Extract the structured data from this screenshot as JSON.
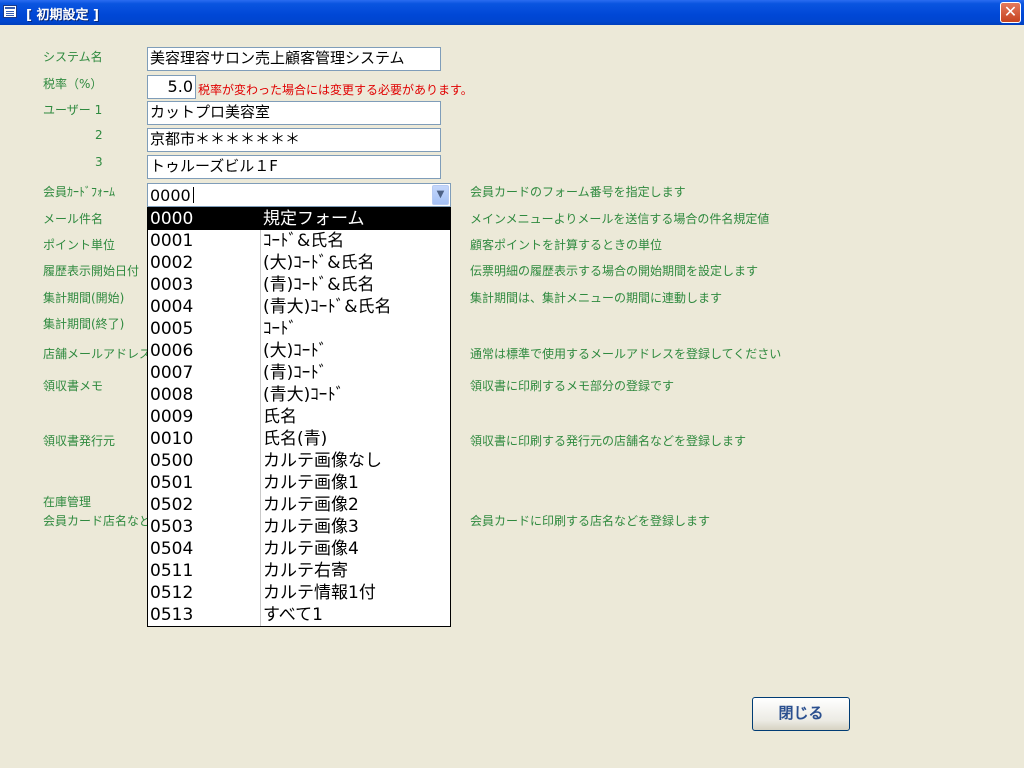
{
  "window": {
    "title": "[ 初期設定 ]",
    "close_glyph": "✕"
  },
  "labels": {
    "system_name": "システム名",
    "tax_rate": "税率（%）",
    "user1": "ユーザー 1",
    "user2": "2",
    "user3": "3",
    "card_form": "会員ｶｰﾄﾞﾌｫｰﾑ",
    "mail_subject": "メール件名",
    "point_unit": "ポイント単位",
    "history_start": "履歴表示開始日付",
    "period_start": "集計期間(開始)",
    "period_end": "集計期間(終了)",
    "store_mail": "店舗メールアドレス",
    "receipt_memo": "領収書メモ",
    "receipt_issuer": "領収書発行元",
    "stock": "在庫管理",
    "card_store": "会員カード店名など"
  },
  "fields": {
    "system_name": "美容理容サロン売上顧客管理システム",
    "tax_rate": "5.0",
    "tax_note": "税率が変わった場合には変更する必要があります。",
    "user1": "カットプロ美容室",
    "user2": "京都市＊＊＊＊＊＊＊",
    "user3": "トゥルーズビル１F",
    "card_form": "0000"
  },
  "hints": {
    "card_form": "会員カードのフォーム番号を指定します",
    "mail_subject": "メインメニューよりメールを送信する場合の件名規定値",
    "point_unit": "顧客ポイントを計算するときの単位",
    "history_start": "伝票明細の履歴表示する場合の開始期間を設定します",
    "period": "集計期間は、集計メニューの期間に連動します",
    "store_mail": "通常は標準で使用するメールアドレスを登録してください",
    "receipt_memo": "領収書に印刷するメモ部分の登録です",
    "receipt_issuer": "領収書に印刷する発行元の店舗名などを登録します",
    "card_store": "会員カードに印刷する店名などを登録します"
  },
  "dropdown": {
    "arrow_glyph": "▼",
    "selected_index": 0,
    "options": [
      {
        "code": "0000",
        "name": "規定フォーム"
      },
      {
        "code": "0001",
        "name": "ｺｰﾄﾞ&氏名"
      },
      {
        "code": "0002",
        "name": "(大)ｺｰﾄﾞ&氏名"
      },
      {
        "code": "0003",
        "name": "(青)ｺｰﾄﾞ&氏名"
      },
      {
        "code": "0004",
        "name": "(青大)ｺｰﾄﾞ&氏名"
      },
      {
        "code": "0005",
        "name": "ｺｰﾄﾞ"
      },
      {
        "code": "0006",
        "name": "(大)ｺｰﾄﾞ"
      },
      {
        "code": "0007",
        "name": "(青)ｺｰﾄﾞ"
      },
      {
        "code": "0008",
        "name": "(青大)ｺｰﾄﾞ"
      },
      {
        "code": "0009",
        "name": "氏名"
      },
      {
        "code": "0010",
        "name": "氏名(青)"
      },
      {
        "code": "0500",
        "name": "カルテ画像なし"
      },
      {
        "code": "0501",
        "name": "カルテ画像1"
      },
      {
        "code": "0502",
        "name": "カルテ画像2"
      },
      {
        "code": "0503",
        "name": "カルテ画像3"
      },
      {
        "code": "0504",
        "name": "カルテ画像4"
      },
      {
        "code": "0511",
        "name": "カルテ右寄"
      },
      {
        "code": "0512",
        "name": "カルテ情報1付"
      },
      {
        "code": "0513",
        "name": "すべて1"
      }
    ]
  },
  "buttons": {
    "close": "閉じる"
  }
}
